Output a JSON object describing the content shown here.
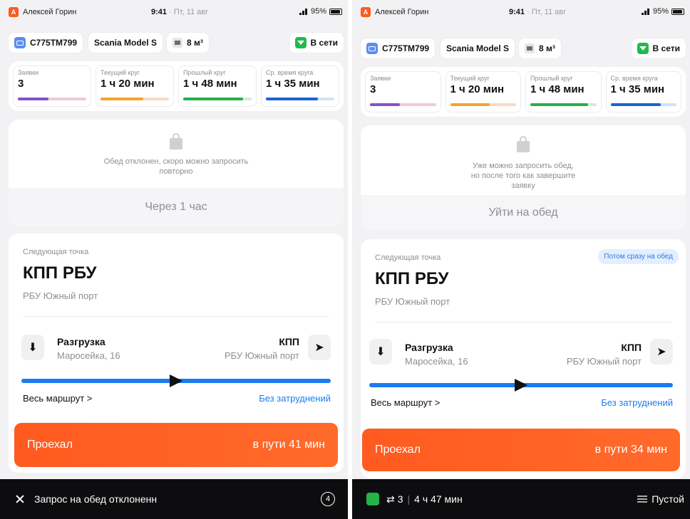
{
  "left": {
    "status": {
      "user_initial": "А",
      "user_name": "Алексей Горин",
      "time": "9:41",
      "date": "· Пт, 11 авг",
      "battery": "95%"
    },
    "topbar": {
      "plate": "С775ТМ799",
      "model": "Scania Model S",
      "volume": "8 м³",
      "online": "В сети"
    },
    "stats": [
      {
        "label": "Заявки",
        "value": "3",
        "color": "#8a4fc9",
        "track": "#f1c8d8",
        "progress": 0.45
      },
      {
        "label": "Текущий круг",
        "value": "1 ч 20 мин",
        "color": "#f6a32a",
        "track": "#fbd9c2",
        "progress": 0.62
      },
      {
        "label": "Прошлый круг",
        "value": "1 ч 48 мин",
        "color": "#23b04a",
        "track": "#cfeed8",
        "progress": 0.88
      },
      {
        "label": "Ср. время круга",
        "value": "1 ч 35 мин",
        "color": "#1a62d8",
        "track": "#cfe3f8",
        "progress": 0.76
      }
    ],
    "lunch": {
      "message": "Обед отклонен, скоро можно запросить повторно",
      "button": "Через 1 час"
    },
    "point": {
      "label": "Следующая точка",
      "title": "КПП РБУ",
      "subtitle": "РБУ Южный порт",
      "from_name": "Разгрузка",
      "from_addr": "Маросейка, 16",
      "to_name": "КПП",
      "to_addr": "РБУ Южный порт",
      "whole_route": "Весь маршрут >",
      "traffic": "Без затруднений",
      "route_progress": 0.5,
      "go_label": "Проехал",
      "go_eta": "в пути 41 мин"
    },
    "bottom": {
      "text": "Запрос на обед отклоненн",
      "count": "4"
    }
  },
  "right": {
    "status": {
      "user_initial": "А",
      "user_name": "Алексей Горин",
      "time": "9:41",
      "date": "· Пт, 11 авг",
      "battery": "95%"
    },
    "topbar": {
      "plate": "С775ТМ799",
      "model": "Scania Model S",
      "volume": "8 м³",
      "online": "В сети"
    },
    "stats": [
      {
        "label": "Заявки",
        "value": "3",
        "color": "#8a4fc9",
        "track": "#f1c8d8",
        "progress": 0.45
      },
      {
        "label": "Текущий круг",
        "value": "1 ч 20 мин",
        "color": "#f6a32a",
        "track": "#fbd9c2",
        "progress": 0.6
      },
      {
        "label": "Прошлый круг",
        "value": "1 ч 48 мин",
        "color": "#23b04a",
        "track": "#cfeed8",
        "progress": 0.88
      },
      {
        "label": "Ср. время круга",
        "value": "1 ч 35 мин",
        "color": "#1a62d8",
        "track": "#cfe3f8",
        "progress": 0.76
      }
    ],
    "lunch": {
      "message": "Уже можно запросить обед, но после того как завершите заявку",
      "button": "Уйти на обед"
    },
    "point": {
      "label": "Следующая точка",
      "badge": "Потом сразу на обед",
      "title": "КПП РБУ",
      "subtitle": "РБУ Южный порт",
      "from_name": "Разгрузка",
      "from_addr": "Маросейка, 16",
      "to_name": "КПП",
      "to_addr": "РБУ Южный порт",
      "whole_route": "Весь маршрут >",
      "traffic": "Без затруднений",
      "route_progress": 0.5,
      "go_label": "Проехал",
      "go_eta": "в пути 34 мин"
    },
    "bottom": {
      "cycles": "3",
      "duration": "4 ч 47 мин",
      "status": "Пустой"
    }
  }
}
